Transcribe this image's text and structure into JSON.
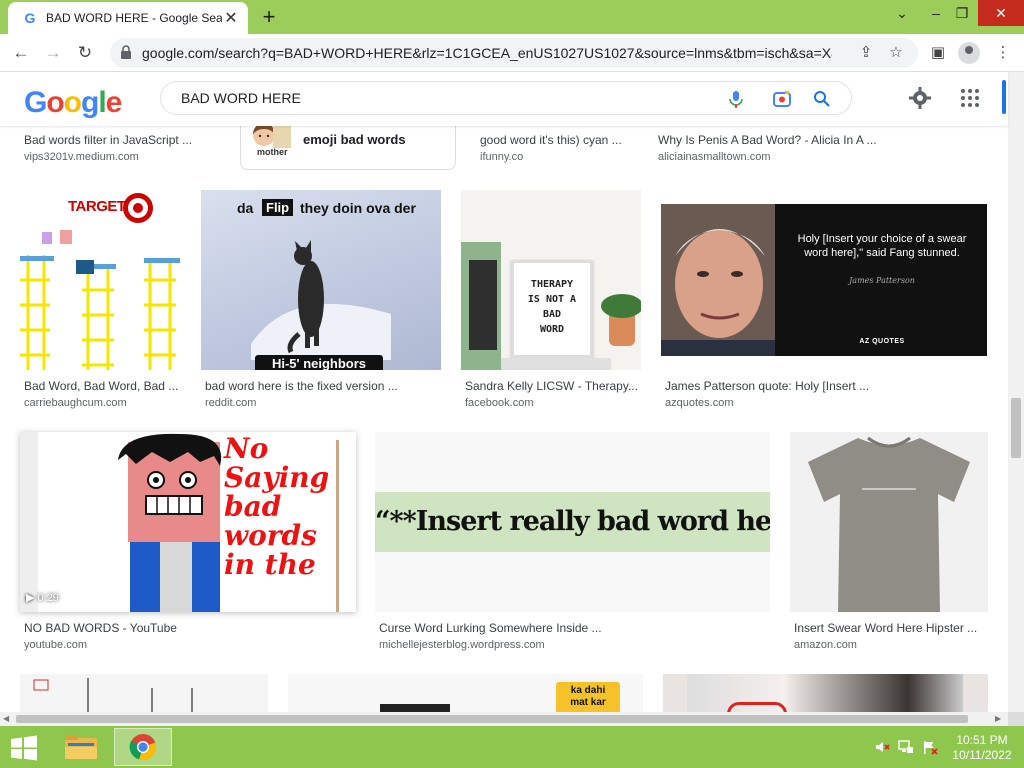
{
  "browser": {
    "tab_title": "BAD WORD HERE - Google Search",
    "new_tab_label": "+",
    "url": "google.com/search?q=BAD+WORD+HERE&rlz=1C1GCEA_enUS1027US1027&source=lnms&tbm=isch&sa=X&v..."
  },
  "google": {
    "logo_text": "Google",
    "search_query": "BAD WORD HERE"
  },
  "results": {
    "row0": [
      {
        "title": "Bad words filter in JavaScript ...",
        "site": "vips3201v.medium.com"
      },
      {
        "title": "emoji bad words",
        "title_bold": "bad words",
        "title_prefix": "emoji",
        "thumb_caption": "mother"
      },
      {
        "title": "good word it's this) cyan ...",
        "site": "ifunny.co"
      },
      {
        "title": "Why Is Penis A Bad Word? - Alicia In A ...",
        "site": "aliciainasmalltown.com"
      }
    ],
    "row1": [
      {
        "title": "Bad Word, Bad Word, Bad ...",
        "site": "carriebaughcum.com",
        "thumb_text": "TARGET"
      },
      {
        "title": "bad word here is the fixed version ...",
        "site": "reddit.com",
        "thumb_text_a": "da",
        "thumb_text_flip": "Flip",
        "thumb_text_b": "they doin ova der",
        "thumb_text_bottom": "Hi-5' neighbors"
      },
      {
        "title": "Sandra Kelly LICSW - Therapy...",
        "site": "facebook.com",
        "thumb_text": [
          "THERAPY",
          "IS NOT A",
          "BAD",
          "WORD"
        ]
      },
      {
        "title": "James Patterson quote: Holy [Insert ...",
        "site": "azquotes.com",
        "thumb_quote": "Holy [Insert your choice of a swear word here],\" said Fang stunned.",
        "thumb_author": "James Patterson",
        "thumb_brand": "AZ QUOTES"
      }
    ],
    "row2": [
      {
        "title": "NO BAD WORDS - YouTube",
        "site": "youtube.com",
        "duration": "0:29",
        "thumb_text": [
          "No",
          "Saying",
          "bad",
          "words",
          "in the"
        ]
      },
      {
        "title": "Curse Word Lurking Somewhere Inside ...",
        "site": "michellejesterblog.wordpress.com",
        "thumb_text": "“**Insert really bad word here**”"
      },
      {
        "title": "Insert Swear Word Here Hipster ...",
        "site": "amazon.com"
      }
    ],
    "row3": [
      {
        "thumb_text": [
          "ka dahi",
          "mat kar"
        ]
      }
    ]
  },
  "taskbar": {
    "time": "10:51 PM",
    "date": "10/11/2022"
  },
  "colors": {
    "titlebar": "#9ccd5a",
    "taskbar": "#8fc64e",
    "close": "#c42b1c",
    "link_blue": "#1a73e8"
  }
}
